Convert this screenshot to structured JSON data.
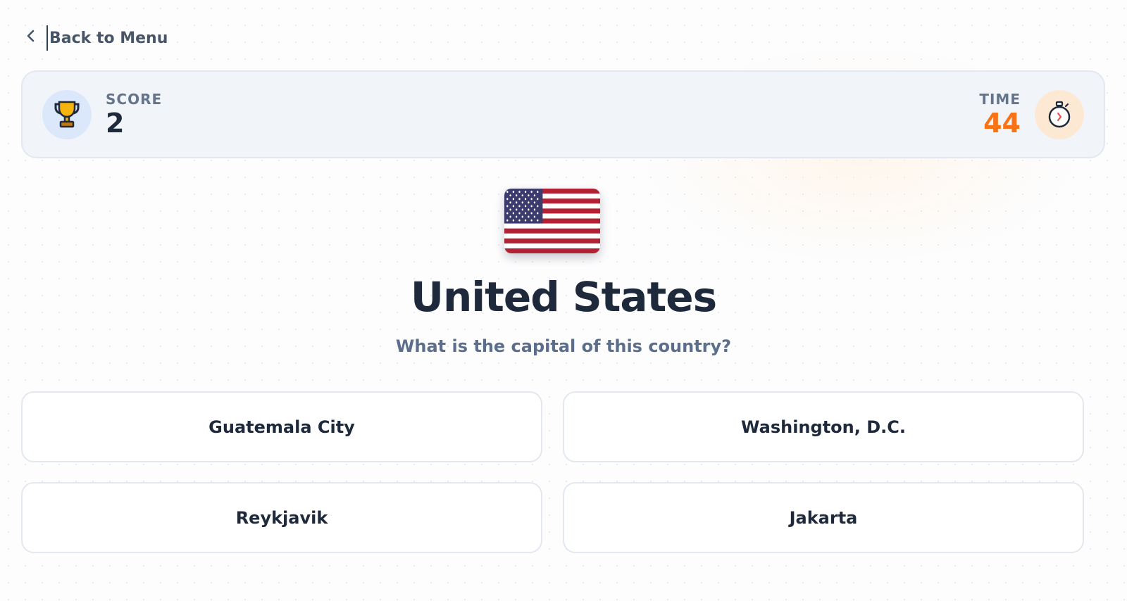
{
  "nav": {
    "back_label": "Back to Menu"
  },
  "scoreboard": {
    "score_label": "SCORE",
    "score_value": "2",
    "time_label": "TIME",
    "time_value": "44"
  },
  "icons": {
    "back": "chevron-left-icon",
    "score": "trophy-icon",
    "time": "stopwatch-icon"
  },
  "question": {
    "flag": "us-flag",
    "country": "United States",
    "prompt": "What is the capital of this country?"
  },
  "answers": [
    {
      "label": "Guatemala City"
    },
    {
      "label": "Washington, D.C."
    },
    {
      "label": "Reykjavik"
    },
    {
      "label": "Jakarta"
    }
  ],
  "colors": {
    "accent_orange": "#f97316",
    "text_dark": "#1e293b",
    "text_muted": "#64748b",
    "scorebar_bg": "#f1f4f9"
  }
}
